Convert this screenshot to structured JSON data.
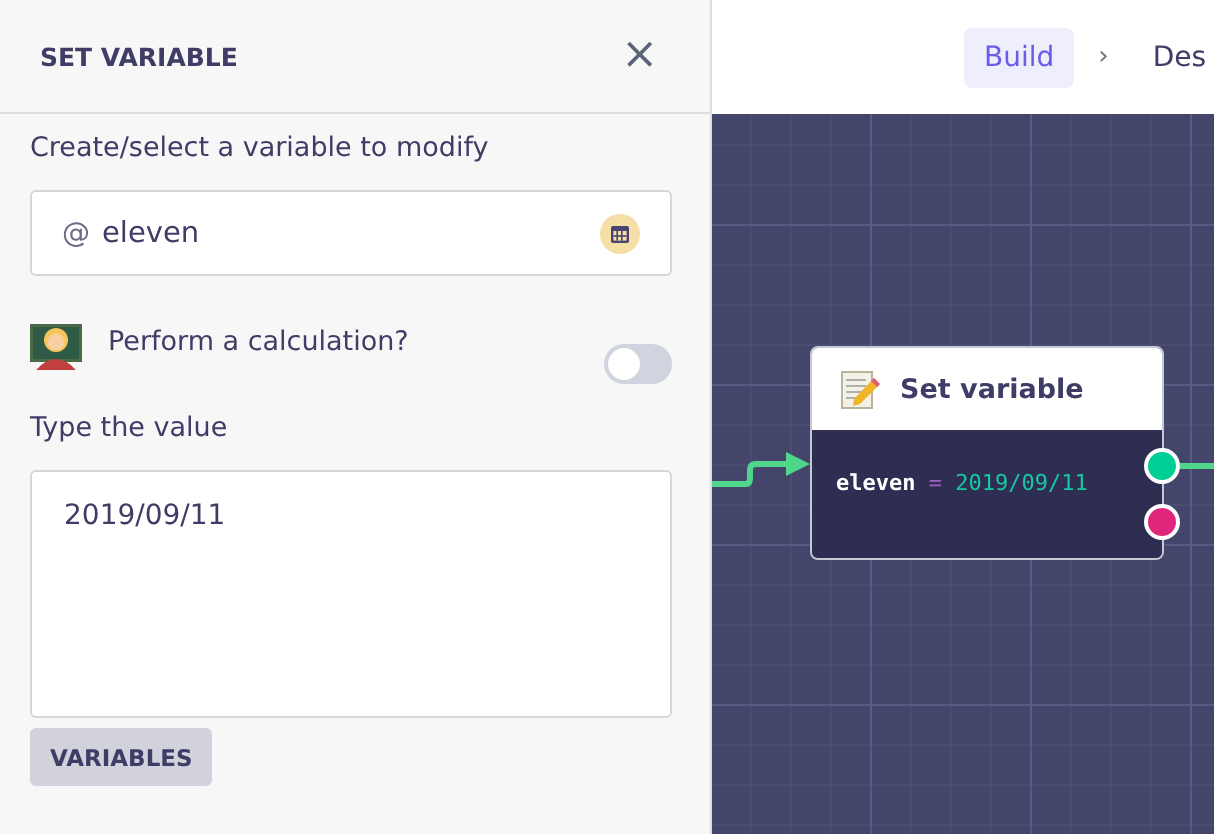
{
  "panel": {
    "title": "SET VARIABLE",
    "close": "×",
    "variable": {
      "label": "Create/select a variable to modify",
      "prefix": "@",
      "value": "eleven"
    },
    "calculation": {
      "label": "Perform a calculation?",
      "on": false
    },
    "value_field": {
      "label": "Type the value",
      "value": "2019/09/11"
    },
    "button": "VARIABLES"
  },
  "breadcrumbs": [
    {
      "label": "Build",
      "selected": true
    },
    {
      "label": "Des",
      "selected": false
    }
  ],
  "breadcrumb_separator": "›",
  "node": {
    "title": "Set variable",
    "name": "eleven",
    "operator": "=",
    "value": "2019/09/11"
  }
}
